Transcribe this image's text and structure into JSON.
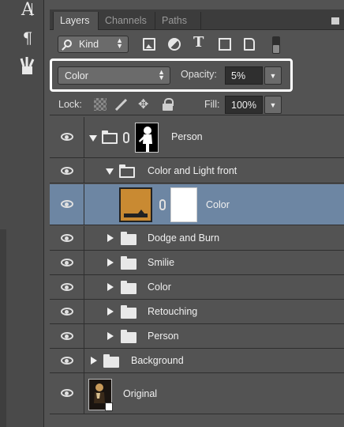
{
  "tabs": [
    "Layers",
    "Channels",
    "Paths"
  ],
  "filter": {
    "kind_label": "Kind"
  },
  "blend": {
    "mode": "Color",
    "opacity_label": "Opacity:",
    "opacity_value": "5%"
  },
  "lock": {
    "label": "Lock:",
    "fill_label": "Fill:",
    "fill_value": "100%"
  },
  "layers": [
    {
      "name": "Person",
      "type": "group-masked",
      "expanded": true,
      "visible": true
    },
    {
      "name": "Color and Light front",
      "type": "group",
      "expanded": true,
      "visible": true
    },
    {
      "name": "Color",
      "type": "fill-layer",
      "selected": true,
      "visible": true
    },
    {
      "name": "Dodge and Burn",
      "type": "group",
      "expanded": false,
      "visible": true
    },
    {
      "name": "Smilie",
      "type": "group",
      "expanded": false,
      "visible": true
    },
    {
      "name": "Color",
      "type": "group",
      "expanded": false,
      "visible": true
    },
    {
      "name": "Retouching",
      "type": "group",
      "expanded": false,
      "visible": true
    },
    {
      "name": "Person",
      "type": "group",
      "expanded": false,
      "visible": true
    },
    {
      "name": "Background",
      "type": "group",
      "expanded": false,
      "visible": true
    },
    {
      "name": "Original",
      "type": "smart-object",
      "visible": true
    }
  ],
  "colors": {
    "panel_bg": "#535353",
    "selected_row": "#6d86a3",
    "fill_color": "#c98a32",
    "highlight_box": "#ffffff"
  }
}
